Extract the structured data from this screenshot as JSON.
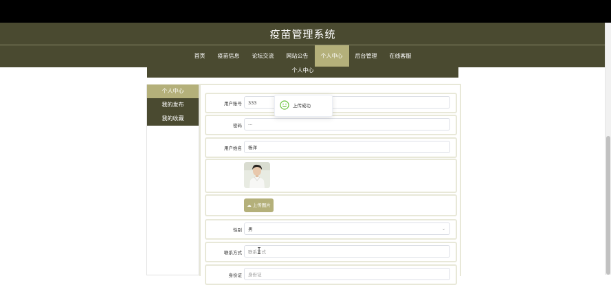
{
  "app": {
    "title": "疫苗管理系统"
  },
  "nav": {
    "items": [
      {
        "label": "首页",
        "active": false
      },
      {
        "label": "疫苗信息",
        "active": false
      },
      {
        "label": "论坛交流",
        "active": false
      },
      {
        "label": "网站公告",
        "active": false
      },
      {
        "label": "个人中心",
        "active": true
      },
      {
        "label": "后台管理",
        "active": false
      },
      {
        "label": "在线客服",
        "active": false
      }
    ]
  },
  "page": {
    "title": "个人中心"
  },
  "sidebar": {
    "items": [
      {
        "label": "个人中心",
        "active": true
      },
      {
        "label": "我的发布",
        "active": false
      },
      {
        "label": "我的收藏",
        "active": false
      }
    ]
  },
  "form": {
    "username": {
      "label": "用户账号",
      "value": "333"
    },
    "password": {
      "label": "密码",
      "value": "···"
    },
    "name": {
      "label": "用户姓名",
      "value": "杨洋"
    },
    "upload": {
      "label": "上传图片"
    },
    "gender": {
      "label": "性别",
      "value": "男"
    },
    "contact": {
      "label": "联系方式",
      "placeholder": "联系方式"
    },
    "idcard": {
      "label": "身份证",
      "placeholder": "身份证"
    }
  },
  "toast": {
    "text": "上传成功"
  },
  "colors": {
    "header": "#4a4a30",
    "accent": "#b4b07a",
    "success": "#67c23a"
  }
}
